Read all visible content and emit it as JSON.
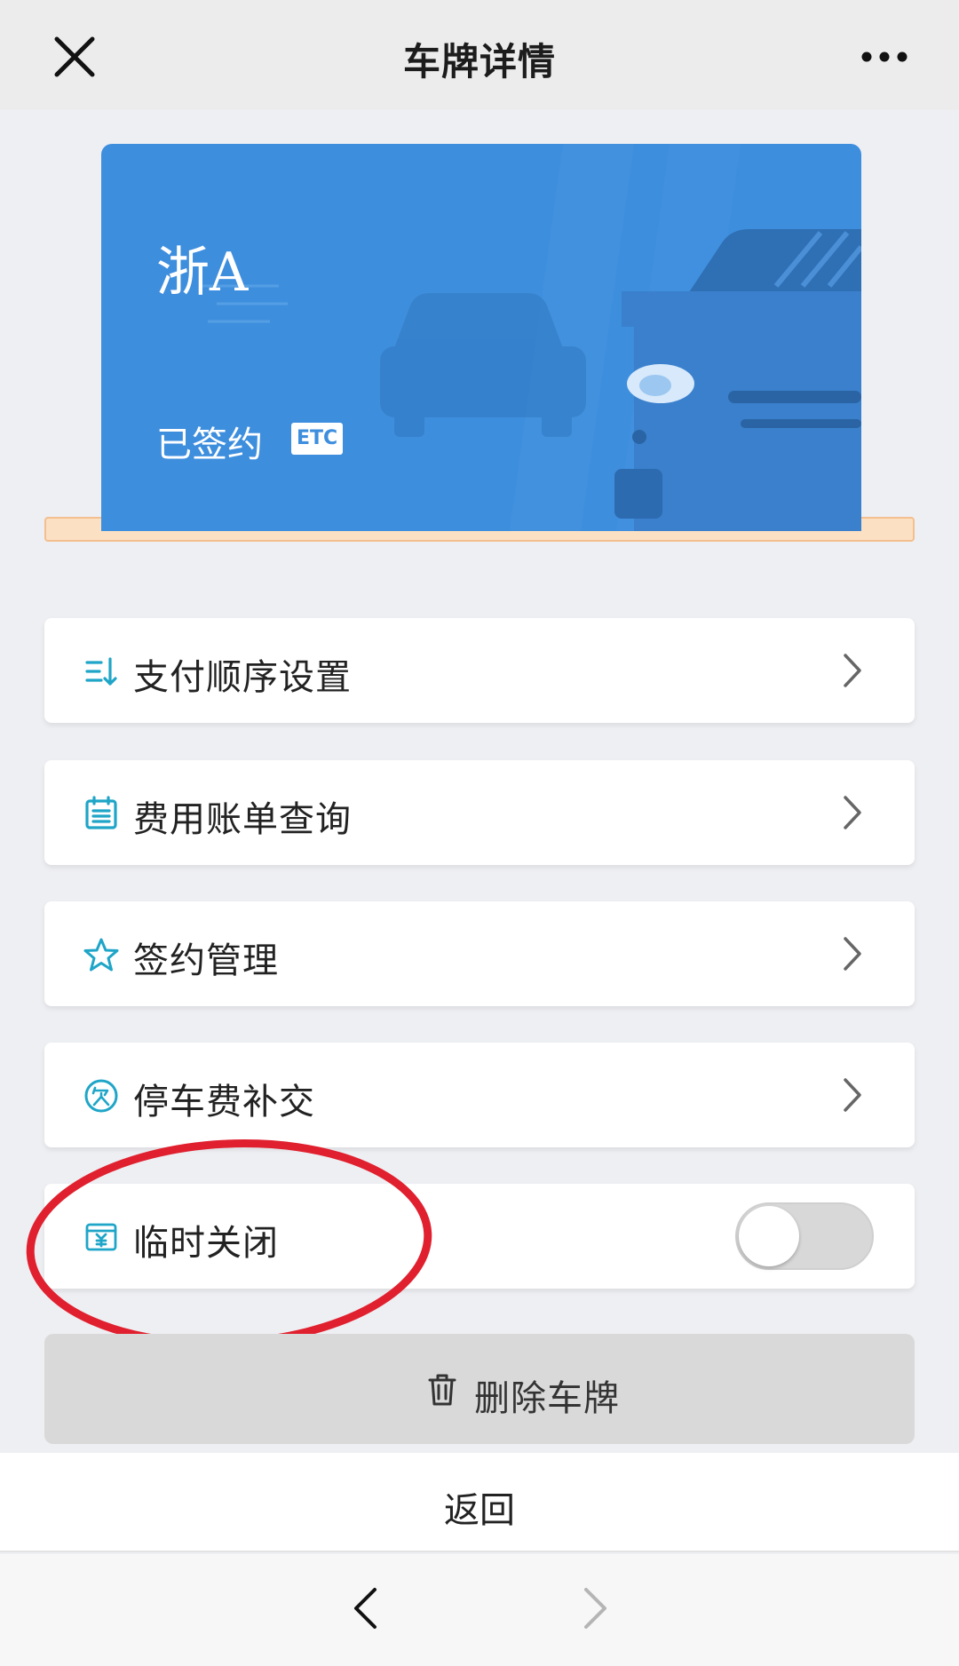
{
  "header": {
    "title": "车牌详情",
    "close_icon": "close-icon",
    "more_icon": "more-icon"
  },
  "plate": {
    "number": "浙A",
    "status": "已签约",
    "badge": "ETC",
    "card_color": "#3e8ede"
  },
  "menu": [
    {
      "label": "支付顺序设置",
      "icon": "sort-icon"
    },
    {
      "label": "费用账单查询",
      "icon": "bill-icon"
    },
    {
      "label": "签约管理",
      "icon": "star-icon"
    },
    {
      "label": "停车费补交",
      "icon": "arrears-icon"
    }
  ],
  "temp_close": {
    "label": "临时关闭",
    "icon": "wallet-icon",
    "enabled": false
  },
  "delete": {
    "label": "删除车牌",
    "icon": "trash-icon"
  },
  "footer": {
    "back_label": "返回"
  },
  "colors": {
    "accent": "#1fa5c8",
    "highlight_ring": "#e0202e"
  }
}
